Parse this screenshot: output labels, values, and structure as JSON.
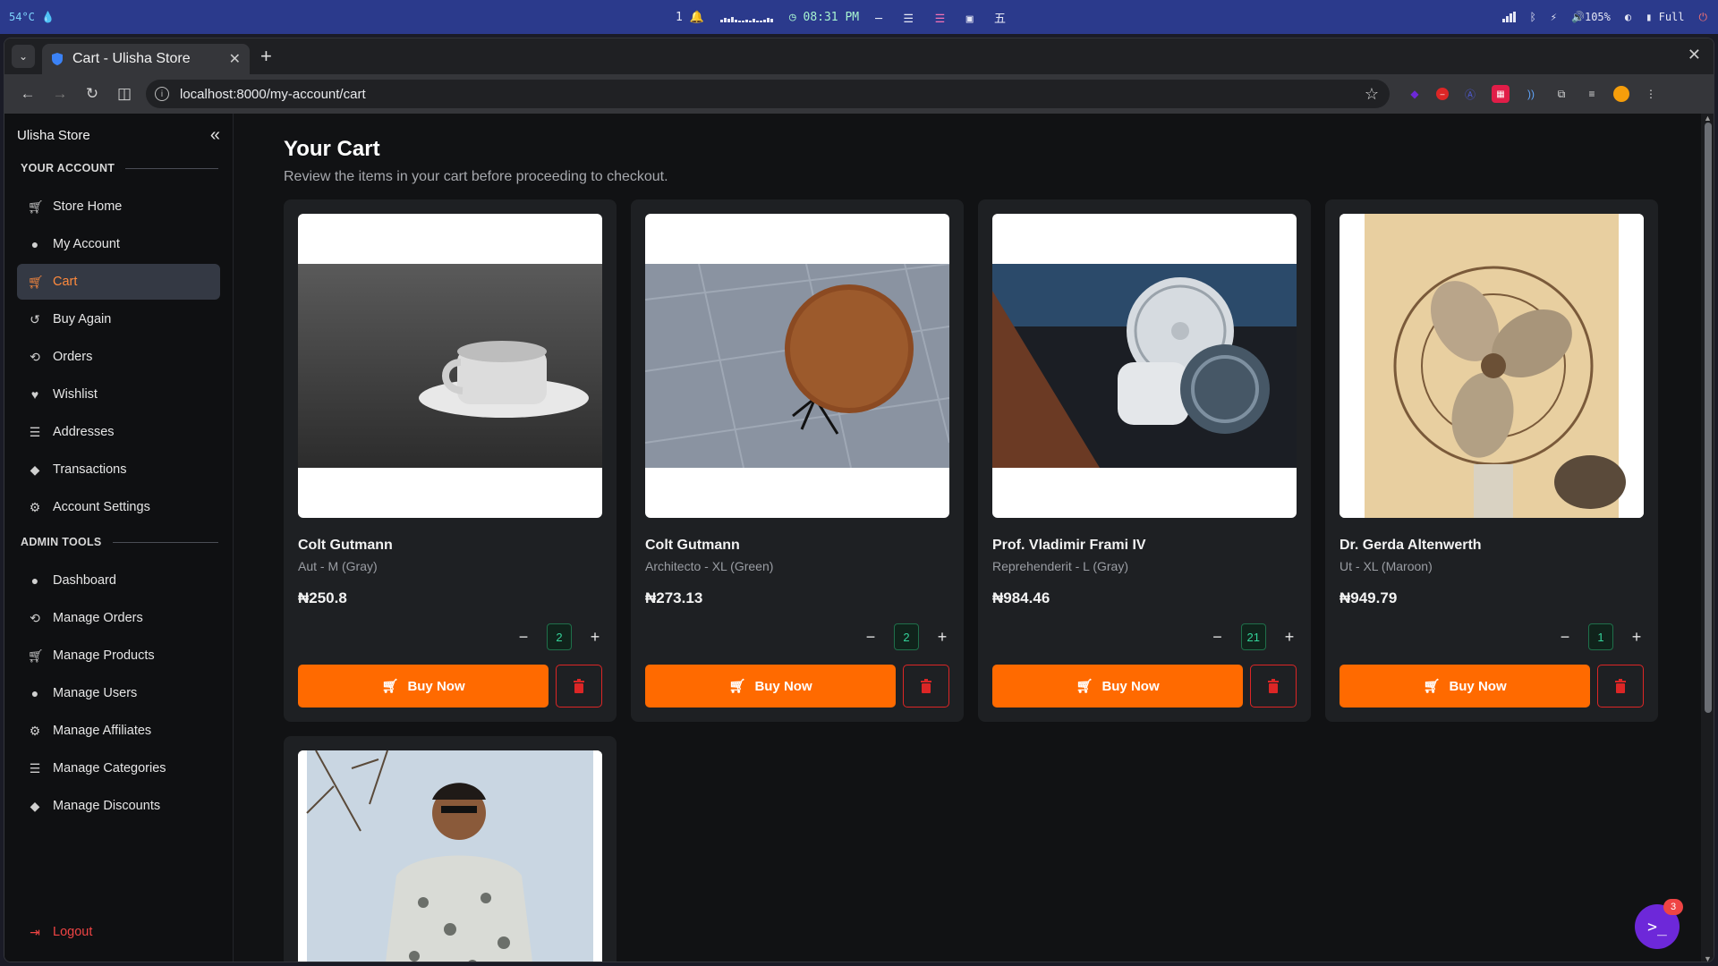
{
  "os_bar": {
    "temp": "54°C",
    "notif_count": "1",
    "time": "08:31 PM",
    "volume": "105%",
    "battery": "Full"
  },
  "browser": {
    "tab_title": "Cart - Ulisha Store",
    "url": "localhost:8000/my-account/cart"
  },
  "sidebar": {
    "store_name": "Ulisha Store",
    "section_account": "YOUR ACCOUNT",
    "account_items": [
      {
        "label": "Store Home",
        "icon": "cart-icon"
      },
      {
        "label": "My Account",
        "icon": "user-circle-icon"
      },
      {
        "label": "Cart",
        "icon": "cart-icon",
        "active": true
      },
      {
        "label": "Buy Again",
        "icon": "redo-icon"
      },
      {
        "label": "Orders",
        "icon": "history-icon"
      },
      {
        "label": "Wishlist",
        "icon": "heart-icon"
      },
      {
        "label": "Addresses",
        "icon": "list-icon"
      },
      {
        "label": "Transactions",
        "icon": "tag-icon"
      },
      {
        "label": "Account Settings",
        "icon": "user-gear-icon"
      }
    ],
    "section_admin": "ADMIN TOOLS",
    "admin_items": [
      {
        "label": "Dashboard",
        "icon": "user-circle-icon"
      },
      {
        "label": "Manage Orders",
        "icon": "history-icon"
      },
      {
        "label": "Manage Products",
        "icon": "cart-icon"
      },
      {
        "label": "Manage Users",
        "icon": "user-circle-icon"
      },
      {
        "label": "Manage Affiliates",
        "icon": "user-gear-icon"
      },
      {
        "label": "Manage Categories",
        "icon": "list-icon"
      },
      {
        "label": "Manage Discounts",
        "icon": "tag-icon"
      }
    ],
    "logout": "Logout"
  },
  "main": {
    "title": "Your Cart",
    "subtitle": "Review the items in your cart before proceeding to checkout.",
    "buy_label": "Buy Now",
    "items": [
      {
        "name": "Colt Gutmann",
        "variant": "Aut - M (Gray)",
        "price": "₦250.8",
        "qty": "2"
      },
      {
        "name": "Colt Gutmann",
        "variant": "Architecto - XL (Green)",
        "price": "₦273.13",
        "qty": "2"
      },
      {
        "name": "Prof. Vladimir Frami IV",
        "variant": "Reprehenderit - L (Gray)",
        "price": "₦984.46",
        "qty": "21"
      },
      {
        "name": "Dr. Gerda Altenwerth",
        "variant": "Ut - XL (Maroon)",
        "price": "₦949.79",
        "qty": "1"
      }
    ]
  },
  "fab": {
    "badge": "3",
    "glyph": ">_"
  },
  "colors": {
    "accent": "#ff6a00",
    "danger": "#dc2626",
    "active_text": "#ff8a3d"
  }
}
